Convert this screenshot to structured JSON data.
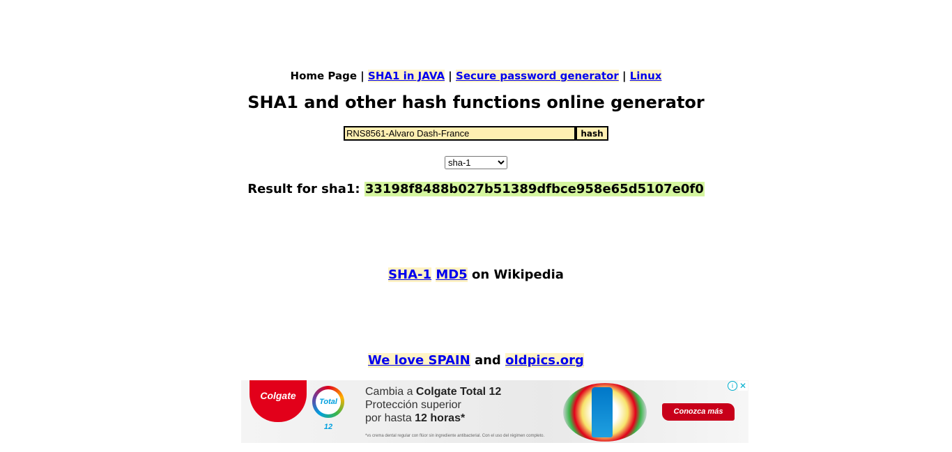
{
  "nav": {
    "home": "Home Page",
    "sep": "|",
    "links": [
      "SHA1 in JAVA",
      "Secure password generator",
      "Linux"
    ]
  },
  "title": "SHA1 and other hash functions online generator",
  "form": {
    "input_value": "RNS8561-Alvaro Dash-France",
    "button_label": "hash",
    "algorithm": "sha-1"
  },
  "result": {
    "label": "Result for sha1:",
    "hash": "33198f8488b027b51389dfbce958e65d5107e0f0"
  },
  "wiki": {
    "links": [
      "SHA-1",
      "MD5"
    ],
    "suffix": "on Wikipedia"
  },
  "promo": {
    "link1": "We love SPAIN",
    "and": "and",
    "link2": "oldpics.org"
  },
  "ad": {
    "brand": "Colgate",
    "badge": "Total 12",
    "line1_prefix": "Cambia a ",
    "line1_bold": "Colgate Total 12",
    "line2": "Protección superior",
    "line3_prefix": "por hasta ",
    "line3_bold": "12 horas*",
    "disclaimer": "*vs crema dental regular con flúor sin ingrediente antibacterial. Con el uso del régimen completo.",
    "cta": "Conozca más",
    "info_icon": "i",
    "close_icon": "✕"
  },
  "colors": {
    "link": "#0000ee",
    "link_highlight": "#fff3c4",
    "input_bg": "#ffefb2",
    "hash_highlight": "#d4f59e",
    "ad_red": "#e2001a"
  }
}
